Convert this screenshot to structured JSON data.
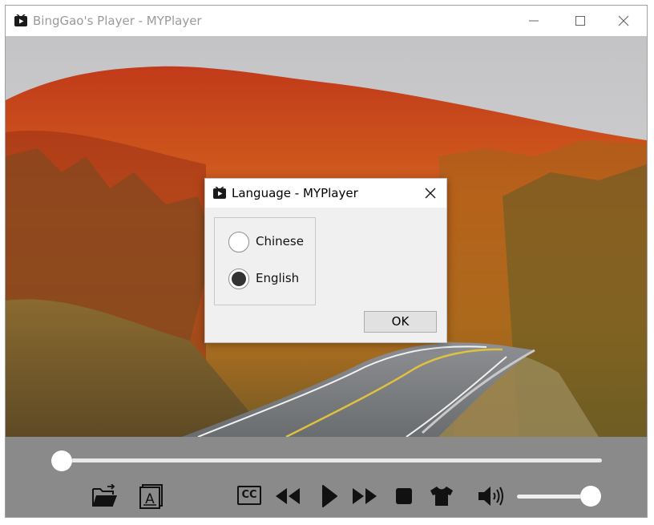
{
  "window": {
    "title": "BingGao's Player - MYPlayer",
    "icon": "player-logo-icon",
    "controls": [
      "minimize-icon",
      "maximize-icon",
      "close-icon"
    ]
  },
  "video": {
    "content": "autumn forest road scene"
  },
  "player_controls": {
    "seek_progress": 0.01,
    "volume_level": 0.9,
    "icons": [
      "open-folder-icon",
      "subtitle-file-icon",
      "closed-caption-icon",
      "rewind-icon",
      "play-icon",
      "fast-forward-icon",
      "stop-icon",
      "skin-shirt-icon",
      "volume-icon"
    ],
    "cc_label": "CC",
    "subtitle_glyph": "A"
  },
  "dialog": {
    "title": "Language - MYPlayer",
    "options": [
      {
        "label": "Chinese",
        "selected": false
      },
      {
        "label": "English",
        "selected": true
      }
    ],
    "ok_label": "OK"
  },
  "colors": {
    "controls_bg": "#8a8a8a",
    "dialog_bg": "#f0f0f0",
    "selected_dot": "#333333"
  }
}
